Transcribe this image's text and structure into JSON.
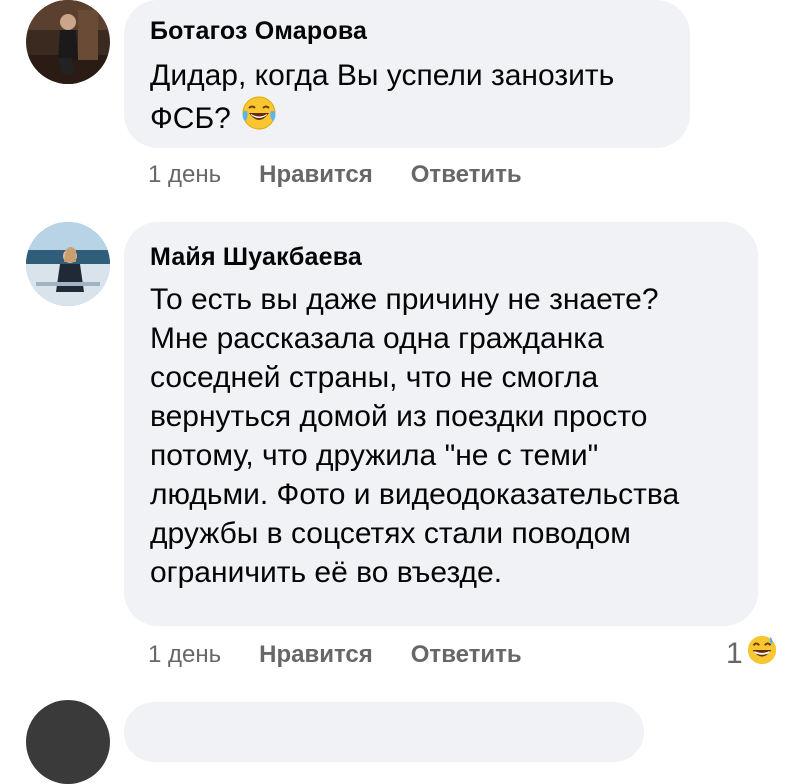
{
  "comments": [
    {
      "author": "Ботагоз Омарова",
      "lines": [
        "Дидар, когда Вы успели занозить",
        "ФСБ?"
      ],
      "emoji": "laughing-tears",
      "time": "1 день",
      "like_label": "Нравится",
      "reply_label": "Ответить"
    },
    {
      "author": "Майя Шуакбаева",
      "lines": [
        "То есть вы даже причину не знаете?",
        "Мне рассказала одна гражданка",
        "соседней страны, что не смогла",
        "вернуться домой из поездки просто",
        "потому, что дружила \"не с теми\"",
        "людьми. Фото и видеодоказательства",
        "дружбы в соцсетях стали поводом",
        "ограничить её во въезде."
      ],
      "time": "1 день",
      "like_label": "Нравится",
      "reply_label": "Ответить",
      "reaction_count": "1",
      "reaction_icon": "grinning-sweat"
    }
  ],
  "colors": {
    "bubble": "#f0f2f5",
    "text": "#050505",
    "secondary": "#65676b"
  }
}
